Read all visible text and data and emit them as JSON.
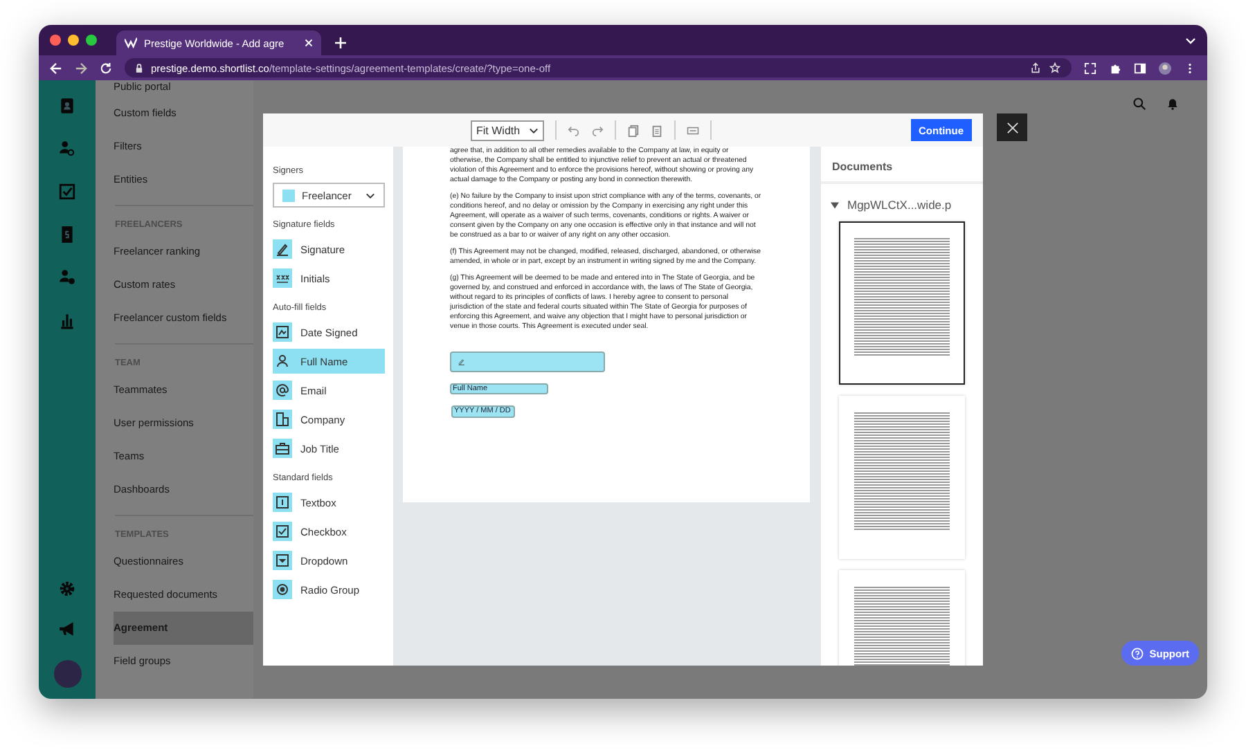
{
  "browser": {
    "tab_title": "Prestige Worldwide - Add agre",
    "url_host": "prestige.demo.shortlist.co",
    "url_path": "/template-settings/agreement-templates/create/?type=one-off"
  },
  "sidebar": {
    "sections": [
      {
        "items": [
          {
            "label": "Public portal",
            "selected": false
          },
          {
            "label": "Custom fields",
            "selected": false
          },
          {
            "label": "Filters",
            "selected": false
          },
          {
            "label": "Entities",
            "selected": false
          }
        ]
      },
      {
        "heading": "FREELANCERS",
        "items": [
          {
            "label": "Freelancer ranking",
            "selected": false
          },
          {
            "label": "Custom rates",
            "selected": false
          },
          {
            "label": "Freelancer custom fields",
            "selected": false
          }
        ]
      },
      {
        "heading": "TEAM",
        "items": [
          {
            "label": "Teammates",
            "selected": false
          },
          {
            "label": "User permissions",
            "selected": false
          },
          {
            "label": "Teams",
            "selected": false
          },
          {
            "label": "Dashboards",
            "selected": false
          }
        ]
      },
      {
        "heading": "TEMPLATES",
        "items": [
          {
            "label": "Questionnaires",
            "selected": false
          },
          {
            "label": "Requested documents",
            "selected": false
          },
          {
            "label": "Agreement",
            "selected": true
          },
          {
            "label": "Field groups",
            "selected": false
          }
        ]
      }
    ]
  },
  "modal": {
    "toolbar": {
      "zoom": "Fit Width",
      "continue": "Continue"
    },
    "left_panel": {
      "signers_label": "Signers",
      "signer": "Freelancer",
      "groups": [
        {
          "heading": "Signature fields",
          "fields": [
            {
              "label": "Signature",
              "kind": "signature",
              "selected": false
            },
            {
              "label": "Initials",
              "kind": "initials",
              "selected": false
            }
          ]
        },
        {
          "heading": "Auto-fill fields",
          "fields": [
            {
              "label": "Date Signed",
              "kind": "date",
              "selected": false
            },
            {
              "label": "Full Name",
              "kind": "person",
              "selected": true
            },
            {
              "label": "Email",
              "kind": "email",
              "selected": false
            },
            {
              "label": "Company",
              "kind": "company",
              "selected": false
            },
            {
              "label": "Job Title",
              "kind": "job",
              "selected": false
            }
          ]
        },
        {
          "heading": "Standard fields",
          "fields": [
            {
              "label": "Textbox",
              "kind": "textbox",
              "selected": false
            },
            {
              "label": "Checkbox",
              "kind": "checkbox",
              "selected": false
            },
            {
              "label": "Dropdown",
              "kind": "dropdown",
              "selected": false
            },
            {
              "label": "Radio Group",
              "kind": "radio",
              "selected": false
            }
          ]
        }
      ]
    },
    "document": {
      "paragraphs": [
        "agree that, in addition to all other remedies available to the Company at law, in equity or otherwise, the Company shall be entitled to injunctive relief to prevent an actual or threatened violation of this Agreement and to enforce the provisions hereof, without showing or proving any actual damage to the Company or posting any bond in connection therewith.",
        "(e) No failure by the Company to insist upon strict compliance with any of the terms, covenants, or conditions hereof, and no delay or omission by the Company in exercising any right under this Agreement, will operate as a waiver of such terms, covenants, conditions or rights. A waiver or consent given by the Company on any one occasion is effective only in that instance and will not be construed as a bar to or waiver of any right on any other occasion.",
        "(f) This Agreement may not be changed, modified, released, discharged, abandoned, or otherwise amended, in whole or in part, except by an instrument in writing signed by me and the Company.",
        "(g) This Agreement will be deemed to be made and entered into in The State of Georgia, and be governed by, and construed and enforced in accordance with, the laws of The State of Georgia, without regard to its principles of conflicts of laws. I hereby agree to consent to personal jurisdiction of the state and federal courts situated within The State of Georgia for purposes of enforcing this Agreement, and waive any objection that I might have to personal jurisdiction or venue in those courts. This Agreement is executed under seal."
      ],
      "fields": [
        {
          "kind": "signature"
        },
        {
          "kind": "text",
          "text": "Full Name"
        },
        {
          "kind": "date",
          "text": "YYYY / MM / DD"
        }
      ]
    },
    "documents_panel": {
      "title": "Documents",
      "file": "MgpWLCtX...wide.p",
      "expanded": true,
      "pages": [
        {
          "selected": true
        },
        {
          "selected": false
        },
        {
          "selected": false
        }
      ]
    }
  },
  "support": "Support"
}
